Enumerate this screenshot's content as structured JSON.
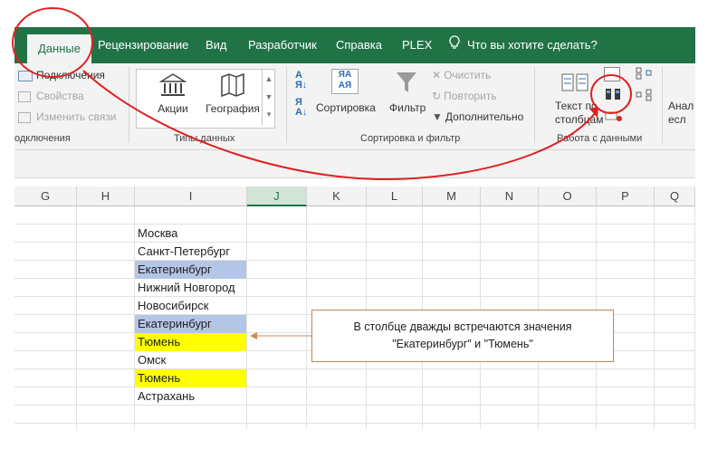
{
  "tabs": [
    {
      "label": "Данные",
      "active": true
    },
    {
      "label": "Рецензирование"
    },
    {
      "label": "Вид"
    },
    {
      "label": "Разработчик"
    },
    {
      "label": "Справка"
    },
    {
      "label": "PLEX"
    }
  ],
  "tell_me": "Что вы хотите сделать?",
  "ribbon": {
    "connections": {
      "items": [
        "Подключения",
        "Свойства",
        "Изменить связи"
      ],
      "group_label": "одключения"
    },
    "data_types": {
      "items": [
        "Акции",
        "География"
      ],
      "group_label": "Типы данных"
    },
    "sort_filter": {
      "sort": "Сортировка",
      "filter": "Фильтр",
      "clear": "Очистить",
      "reapply": "Повторить",
      "advanced": "Дополнительно",
      "group_label": "Сортировка и фильтр"
    },
    "data_tools": {
      "text_to_columns_line1": "Текст по",
      "text_to_columns_line2": "столбцам",
      "group_label": "Работа с данными"
    },
    "analysis_line1": "Анал",
    "analysis_line2": "есл"
  },
  "columns": [
    "G",
    "H",
    "I",
    "J",
    "K",
    "L",
    "M",
    "N",
    "O",
    "P",
    "Q"
  ],
  "selected_column": "J",
  "cells": [
    {
      "text": "Москва",
      "highlight": ""
    },
    {
      "text": "Санкт-Петербург",
      "highlight": ""
    },
    {
      "text": "Екатеринбург",
      "highlight": "#b4c6e7"
    },
    {
      "text": "Нижний Новгород",
      "highlight": ""
    },
    {
      "text": "Новосибирск",
      "highlight": ""
    },
    {
      "text": "Екатеринбург",
      "highlight": "#b4c6e7"
    },
    {
      "text": "Тюмень",
      "highlight": "#ffff00"
    },
    {
      "text": "Омск",
      "highlight": ""
    },
    {
      "text": "Тюмень",
      "highlight": "#ffff00"
    },
    {
      "text": "Астрахань",
      "highlight": ""
    }
  ],
  "callout": {
    "line1": "В столбце дважды встречаются значения",
    "line2": "\"Екатеринбург\" и \"Тюмень\""
  },
  "colors": {
    "ribbon_green": "#217346",
    "annotation_red": "#e02020",
    "dup_blue": "#b4c6e7",
    "dup_yellow": "#ffff00"
  }
}
